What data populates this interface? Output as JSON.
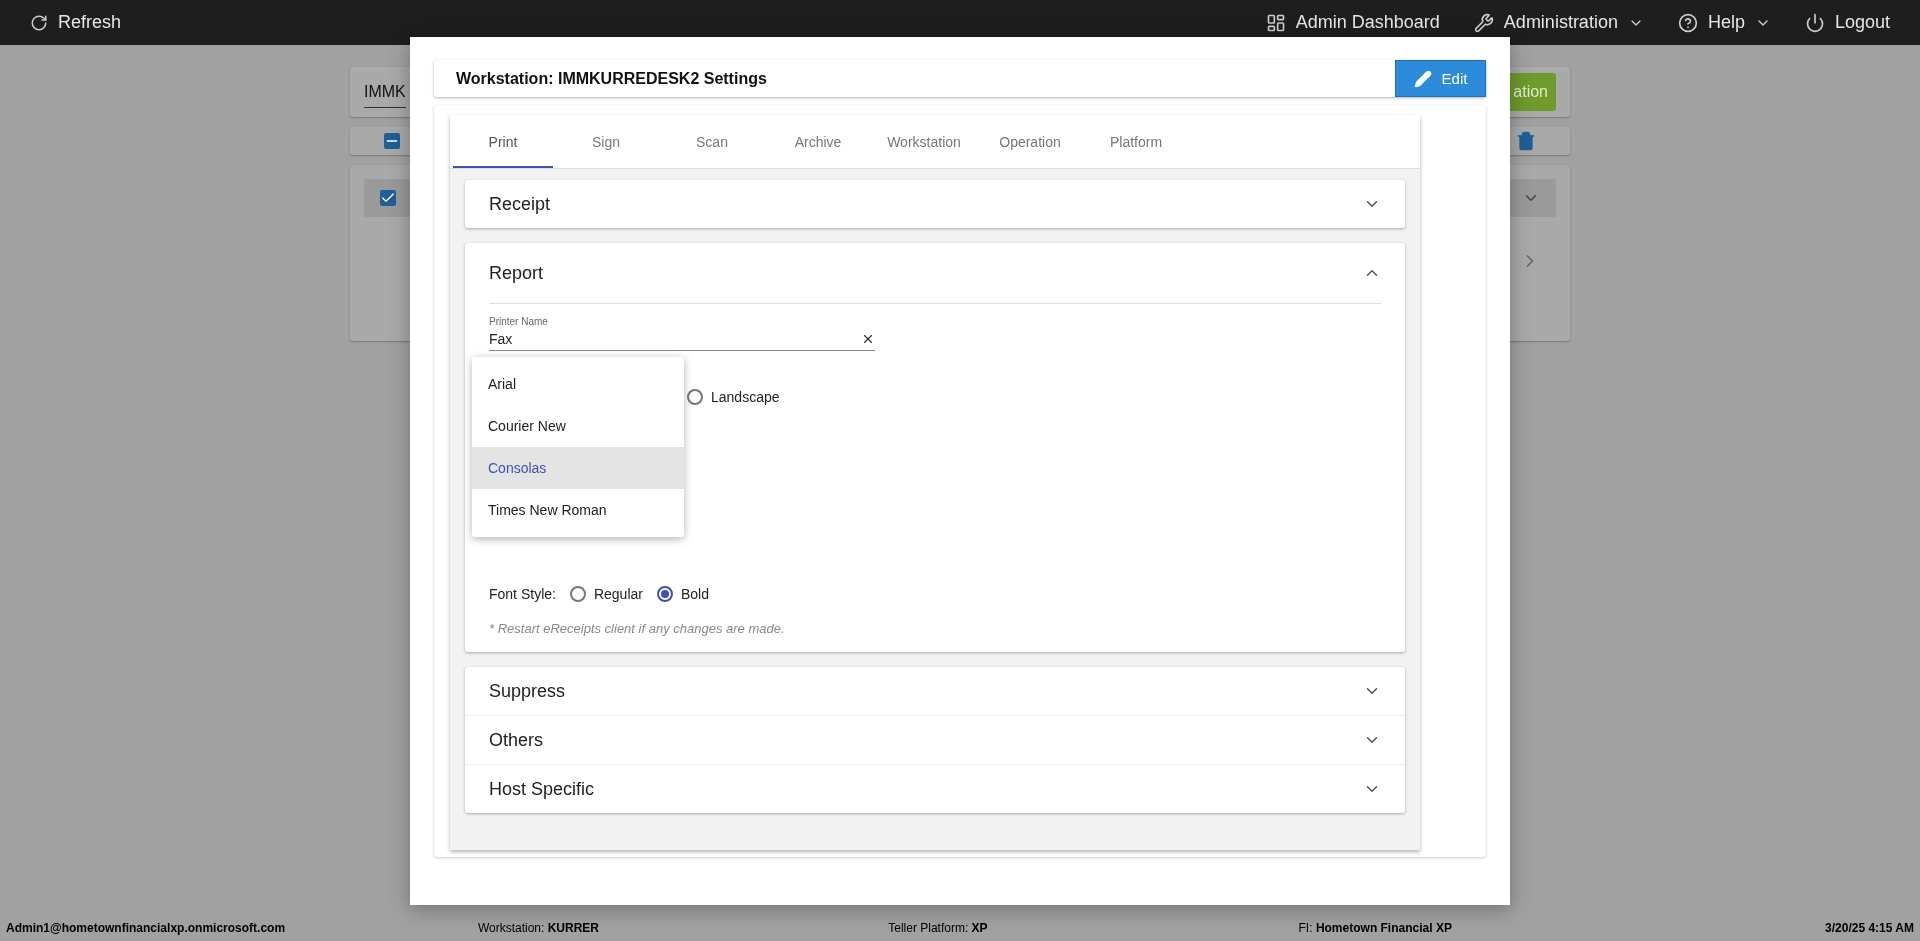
{
  "top_bar": {
    "refresh": "Refresh",
    "items": [
      {
        "label": "Admin Dashboard",
        "kind": "dashboard",
        "has_menu": false
      },
      {
        "label": "Administration",
        "kind": "tools",
        "has_menu": true
      },
      {
        "label": "Help",
        "kind": "help",
        "has_menu": true
      },
      {
        "label": "Logout",
        "kind": "logout",
        "has_menu": false
      }
    ]
  },
  "background": {
    "search_value": "IMMK",
    "button_label": "ation"
  },
  "dialog": {
    "title": "Workstation: IMMKURREDESK2 Settings",
    "edit_button": "Edit",
    "tabs": [
      {
        "label": "Print",
        "selected": true
      },
      {
        "label": "Sign",
        "selected": false
      },
      {
        "label": "Scan",
        "selected": false
      },
      {
        "label": "Archive",
        "selected": false
      },
      {
        "label": "Workstation",
        "selected": false
      },
      {
        "label": "Operation",
        "selected": false
      },
      {
        "label": "Platform",
        "selected": false
      }
    ],
    "receipt": {
      "title": "Receipt",
      "expanded": false
    },
    "report": {
      "title": "Report",
      "expanded": true,
      "printer_name": {
        "label": "Printer Name",
        "value": "Fax"
      },
      "orientation_option": {
        "label": "Landscape",
        "selected": false
      },
      "font_menu": [
        {
          "label": "Arial",
          "selected": false
        },
        {
          "label": "Courier New",
          "selected": false
        },
        {
          "label": "Consolas",
          "selected": true
        },
        {
          "label": "Times New Roman",
          "selected": false
        }
      ],
      "font_style": {
        "label": "Font Style:",
        "options": [
          {
            "label": "Regular",
            "selected": false
          },
          {
            "label": "Bold",
            "selected": true
          }
        ]
      },
      "note": "* Restart eReceipts client if any changes are made."
    },
    "more_sections": [
      {
        "title": "Suppress",
        "expanded": false
      },
      {
        "title": "Others",
        "expanded": false
      },
      {
        "title": "Host Specific",
        "expanded": false
      }
    ]
  },
  "status_bar": [
    {
      "value": "Admin1@hometownfinancialxp.onmicrosoft.com"
    },
    {
      "label": "Workstation:",
      "value": "KURRER"
    },
    {
      "label": "Teller Platform:",
      "value": "XP"
    },
    {
      "label": "FI:",
      "value": "Hometown Financial XP"
    },
    {
      "value": "3/20/25 4:15 AM"
    }
  ]
}
